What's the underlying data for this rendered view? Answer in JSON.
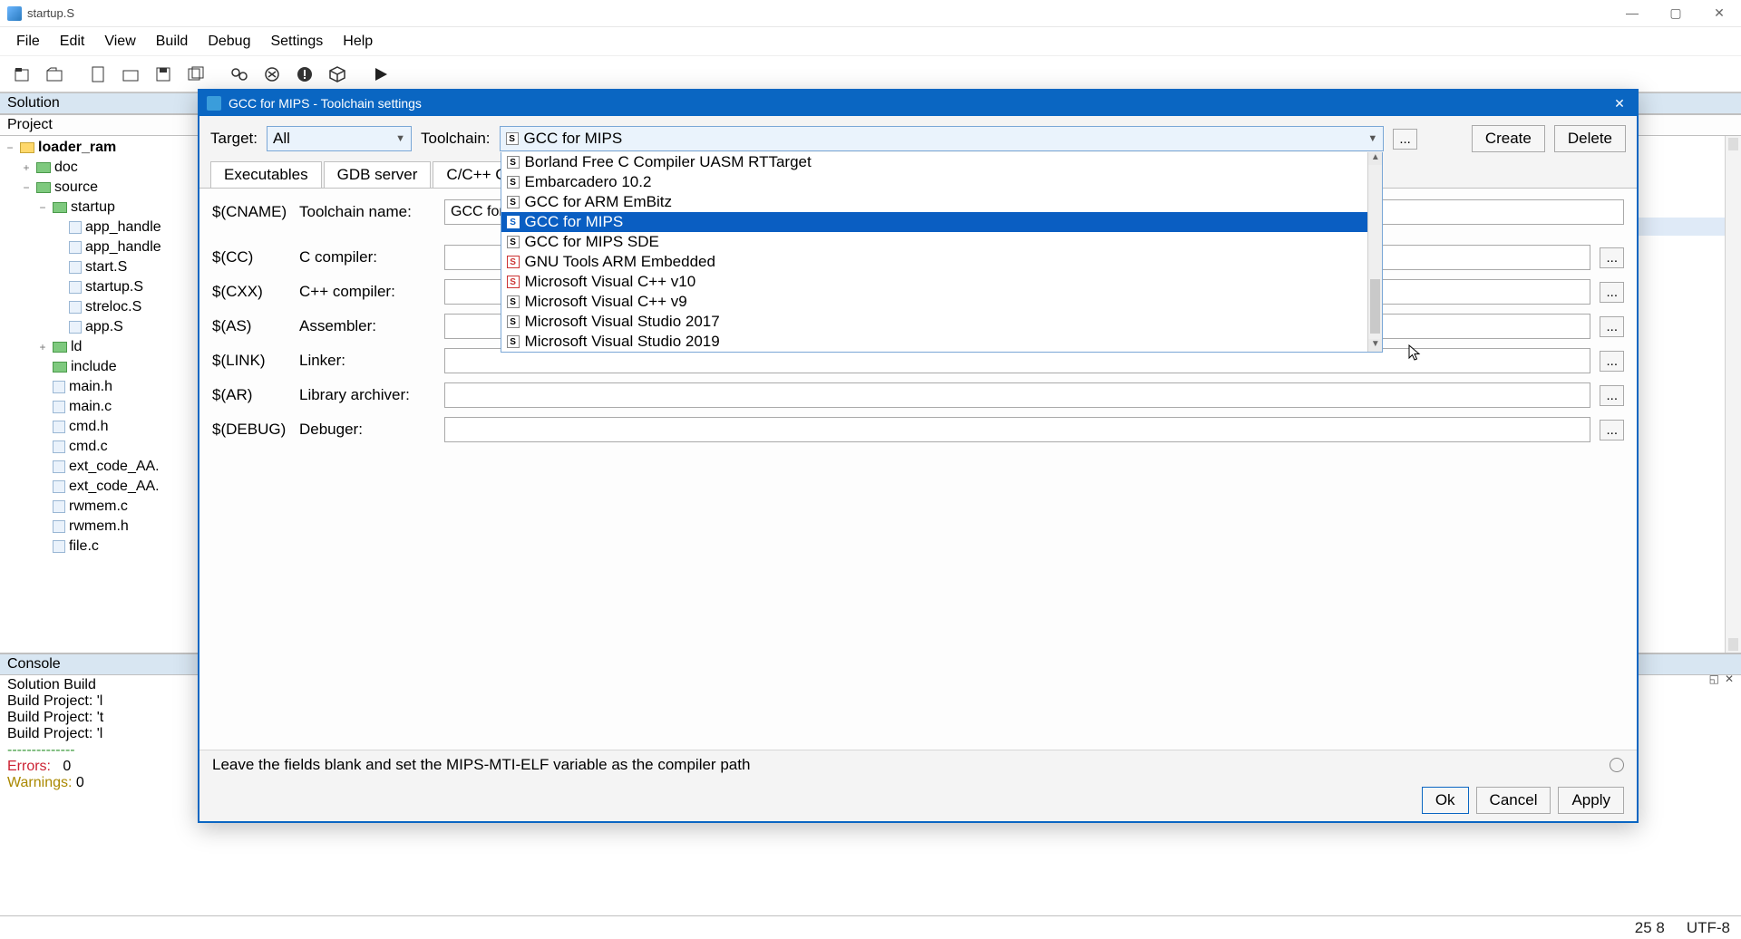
{
  "window": {
    "title": "startup.S"
  },
  "menus": [
    "File",
    "Edit",
    "View",
    "Build",
    "Debug",
    "Settings",
    "Help"
  ],
  "panels": {
    "solution": "Solution",
    "project": "Project",
    "console": "Console"
  },
  "tree": {
    "root": "loader_ram",
    "doc": "doc",
    "source": "source",
    "startup": "startup",
    "files_startup": [
      "app_handle",
      "app_handle",
      "start.S",
      "startup.S",
      "streloc.S",
      "app.S"
    ],
    "ld": "ld",
    "include": "include",
    "files_root": [
      "main.h",
      "main.c",
      "cmd.h",
      "cmd.c",
      "ext_code_AA.",
      "ext_code_AA.",
      "rwmem.c",
      "rwmem.h",
      "file.c"
    ]
  },
  "console": {
    "l1": "Solution Build",
    "l2": "Build Project: 'l",
    "l3": "Build Project: 't",
    "l4": "Build Project: 'l",
    "dash": "--------------",
    "errors_label": "Errors:",
    "errors_val": "0",
    "warnings_label": "Warnings:",
    "warnings_val": "0"
  },
  "dialog": {
    "title": "GCC for MIPS - Toolchain settings",
    "target_label": "Target:",
    "target_value": "All",
    "toolchain_label": "Toolchain:",
    "toolchain_value": "GCC for MIPS",
    "dots": "...",
    "create": "Create",
    "delete": "Delete",
    "tabs": [
      "Executables",
      "GDB server",
      "C/C++ C"
    ],
    "name_var": "$(CNAME)",
    "name_label": "Toolchain name:",
    "name_value": "GCC for M",
    "rows": [
      {
        "var": "$(CC)",
        "label": "C compiler:"
      },
      {
        "var": "$(CXX)",
        "label": "C++ compiler:"
      },
      {
        "var": "$(AS)",
        "label": "Assembler:"
      },
      {
        "var": "$(LINK)",
        "label": "Linker:"
      },
      {
        "var": "$(AR)",
        "label": "Library archiver:"
      },
      {
        "var": "$(DEBUG)",
        "label": "Debuger:"
      }
    ],
    "dropdown": [
      {
        "label": "Borland Free C Compiler UASM RTTarget",
        "red": false
      },
      {
        "label": "Embarcadero 10.2",
        "red": false
      },
      {
        "label": "GCC for ARM EmBitz",
        "red": false
      },
      {
        "label": "GCC for MIPS",
        "red": true,
        "selected": true
      },
      {
        "label": "GCC for MIPS SDE",
        "red": false
      },
      {
        "label": "GNU Tools ARM Embedded",
        "red": true
      },
      {
        "label": "Microsoft Visual C++ v10",
        "red": true
      },
      {
        "label": "Microsoft Visual C++ v9",
        "red": false
      },
      {
        "label": "Microsoft Visual Studio 2017",
        "red": false
      },
      {
        "label": "Microsoft Visual Studio 2019",
        "red": false
      }
    ],
    "hint": "Leave the fields blank and set the MIPS-MTI-ELF variable as the compiler path",
    "ok": "Ok",
    "cancel": "Cancel",
    "apply": "Apply"
  },
  "status": {
    "pos": "25 8",
    "enc": "UTF-8"
  }
}
